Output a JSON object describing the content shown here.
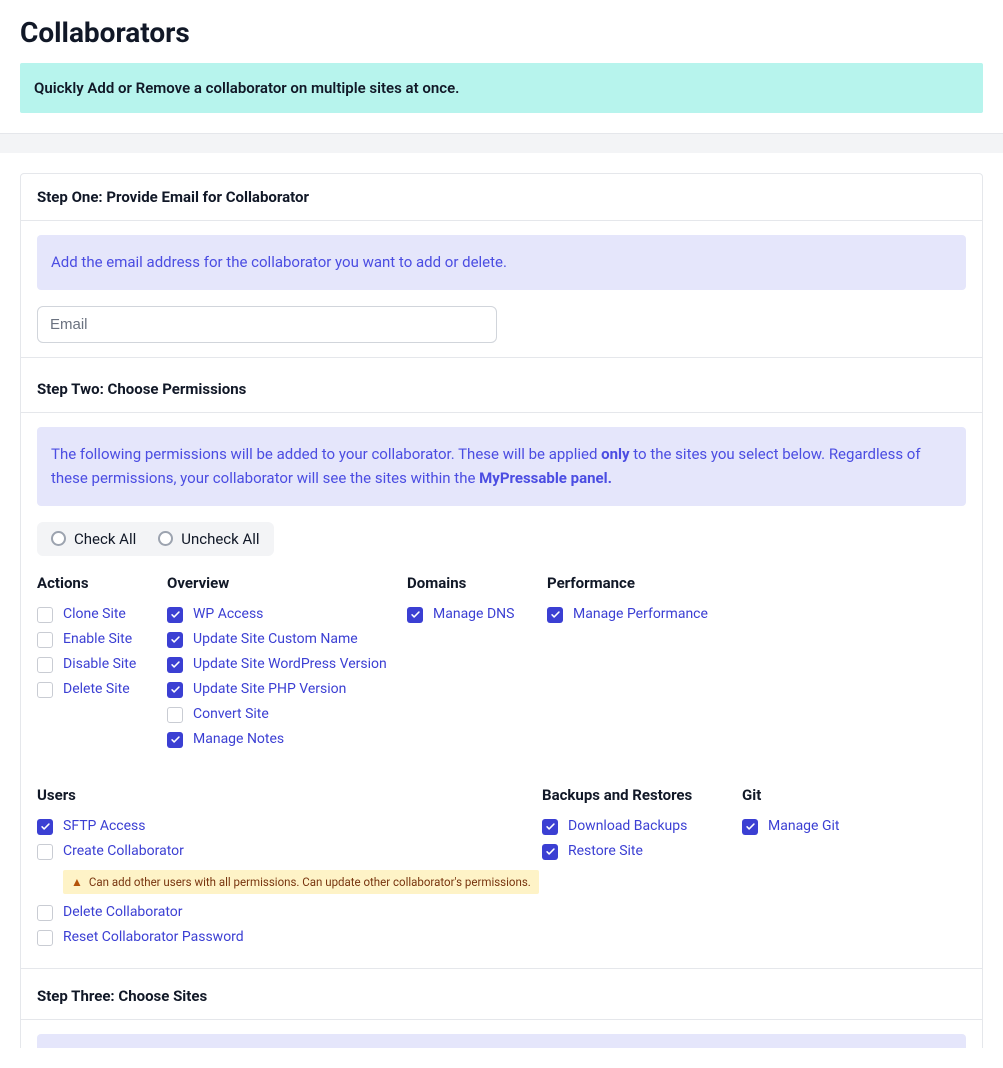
{
  "page_title": "Collaborators",
  "top_alert": "Quickly Add or Remove a collaborator on multiple sites at once.",
  "step1": {
    "title": "Step One: Provide Email for Collaborator",
    "info": "Add the email address for the collaborator you want to add or delete.",
    "placeholder": "Email"
  },
  "step2": {
    "title": "Step Two: Choose Permissions",
    "info_a": "The following permissions will be added to your collaborator. These will be applied ",
    "info_only": "only",
    "info_b": " to the sites you select below. Regardless of these permissions, your collaborator will see the sites within the ",
    "info_c": "MyPressable panel.",
    "check_all": "Check All",
    "uncheck_all": "Uncheck All",
    "groups_row1": {
      "actions": {
        "title": "Actions",
        "items": [
          {
            "label": "Clone Site",
            "checked": false
          },
          {
            "label": "Enable Site",
            "checked": false
          },
          {
            "label": "Disable Site",
            "checked": false
          },
          {
            "label": "Delete Site",
            "checked": false
          }
        ]
      },
      "overview": {
        "title": "Overview",
        "items": [
          {
            "label": "WP Access",
            "checked": true
          },
          {
            "label": "Update Site Custom Name",
            "checked": true
          },
          {
            "label": "Update Site WordPress Version",
            "checked": true
          },
          {
            "label": "Update Site PHP Version",
            "checked": true
          },
          {
            "label": "Convert Site",
            "checked": false
          },
          {
            "label": "Manage Notes",
            "checked": true
          }
        ]
      },
      "domains": {
        "title": "Domains",
        "items": [
          {
            "label": "Manage DNS",
            "checked": true
          }
        ]
      },
      "performance": {
        "title": "Performance",
        "items": [
          {
            "label": "Manage Performance",
            "checked": true
          }
        ]
      }
    },
    "groups_row2": {
      "users": {
        "title": "Users",
        "items_a": [
          {
            "label": "SFTP Access",
            "checked": true
          },
          {
            "label": "Create Collaborator",
            "checked": false
          }
        ],
        "warn": "Can add other users with all permissions. Can update other collaborator's permissions.",
        "items_b": [
          {
            "label": "Delete Collaborator",
            "checked": false
          },
          {
            "label": "Reset Collaborator Password",
            "checked": false
          }
        ]
      },
      "backups": {
        "title": "Backups and Restores",
        "items": [
          {
            "label": "Download Backups",
            "checked": true
          },
          {
            "label": "Restore Site",
            "checked": true
          }
        ]
      },
      "git": {
        "title": "Git",
        "items": [
          {
            "label": "Manage Git",
            "checked": true
          }
        ]
      }
    }
  },
  "step3": {
    "title": "Step Three: Choose Sites"
  }
}
